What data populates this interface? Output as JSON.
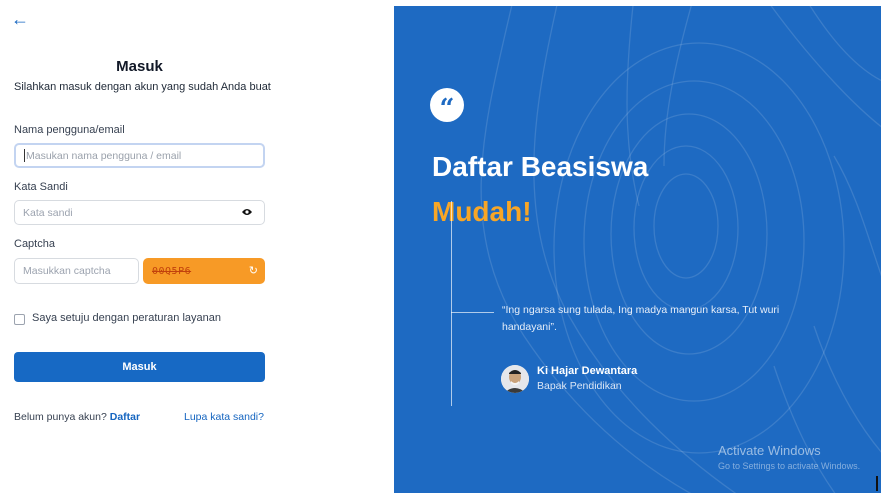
{
  "form": {
    "back_icon": "arrow-left-icon",
    "title": "Masuk",
    "subtitle": "Silahkan masuk dengan akun yang sudah Anda buat",
    "username_label": "Nama pengguna/email",
    "username_placeholder": "Masukan nama pengguna / email",
    "password_label": "Kata Sandi",
    "password_placeholder": "Kata sandi",
    "password_toggle_icon": "eye-icon",
    "captcha_label": "Captcha",
    "captcha_placeholder": "Masukkan captcha",
    "captcha_code": "00Q5P6",
    "captcha_refresh_icon": "refresh-icon",
    "agree_label": "Saya setuju dengan peraturan layanan",
    "submit_label": "Masuk",
    "no_account_text": "Belum punya akun?",
    "signup_link": "Daftar",
    "forgot_link": "Lupa kata sandi?"
  },
  "hero": {
    "quote_icon": "quote-icon",
    "title": "Daftar Beasiswa",
    "accent": "Mudah!",
    "quote": "“Ing ngarsa sung tulada, Ing madya mangun karsa, Tut wuri handayani”.",
    "author_name": "Ki Hajar Dewantara",
    "author_role": "Bapak Pendidikan"
  },
  "watermark": {
    "title": "Activate Windows",
    "subtitle": "Go to Settings to activate Windows."
  },
  "colors": {
    "primary": "#1769c4",
    "hero_bg": "#1e6ac2",
    "accent": "#f8a626",
    "captcha_bg": "#f79a26"
  }
}
